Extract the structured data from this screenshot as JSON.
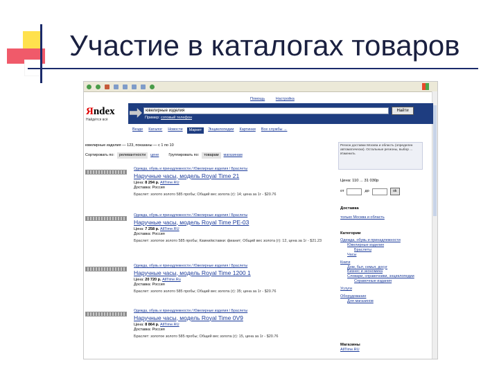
{
  "slide": {
    "title": "Участие в каталогах товаров"
  },
  "toplinks": [
    "Помощь",
    "Настройка"
  ],
  "logo": {
    "y": "Я",
    "rest": "ndex",
    "sub": "Найдётся всё"
  },
  "search": {
    "value": "ювелирные изделия",
    "button": "Найти",
    "example_prefix": "Пример: ",
    "example": "сотовый телефон"
  },
  "tabs": [
    "Везде",
    "Каталог",
    "Новости",
    "Маркет",
    "Энциклопедии",
    "Картинки",
    "Все службы →"
  ],
  "results": {
    "found": "ювелирные изделия — 123, показаны — с 1 по 10",
    "sort_label": "Сортировать по:",
    "sort_relevance": "релевантности",
    "sort_price": "цене",
    "group_label": "Группировать по:",
    "group_goods": "товарам",
    "group_shops": "магазинам"
  },
  "region": "Регион доставки Москва и область (определен автоматически). Остальные регионы, выбор ... Изменить",
  "products": [
    {
      "crumb": "Одежда, обувь и принадлежности / Ювелирные изделия / Браслеты",
      "title": "Наручные часы, модель Royal Time 21",
      "price_label": "Цена: ",
      "price": "8 294 р.",
      "shop": "AllTime.RU",
      "delivery": "Доставка: Россия",
      "desc": "Браслет: золото золото 585 пробы; Общий вес золота (г): 14; цена за 1г - $20.76"
    },
    {
      "crumb": "Одежда, обувь и принадлежности / Ювелирные изделия / Браслеты",
      "title": "Наручные часы, модель Royal Time РЕ-03",
      "price_label": "Цена: ",
      "price": "7 258 р.",
      "shop": "AllTime.RU",
      "delivery": "Доставка: Россия",
      "desc": "Браслет: золотое золото 585 пробы; Камни/вставки: фианит; Общий вес золота (г): 12, цена за 1г - $21.23"
    },
    {
      "crumb": "Одежда, обувь и принадлежности / Ювелирные изделия / Браслеты",
      "title": "Наручные часы, модель Royal Time 1200 1",
      "price_label": "Цена: ",
      "price": "20 720 р.",
      "shop": "AllTime.Ru",
      "delivery": "Доставка: Россия",
      "desc": "Браслет: золото золото 585 пробы; Общий вес золота (г): 35; цена за 1г - $20.76"
    },
    {
      "crumb": "Одежда, обувь и принадлежности / Ювелирные изделия / Браслеты",
      "title": "Наручные часы, модель Royal Time 0V9",
      "price_label": "Цена: ",
      "price": "8 864 р.",
      "shop": "AllTime.RU",
      "delivery": "Доставка: Россия",
      "desc": "Браслет: золотое золото 585 пробы; Общий вес золота (г): 15, цена за 1г - $20.76"
    }
  ],
  "sidebar": {
    "price_title": "Цена: 110 ... 31 030р",
    "from": "от",
    "to": "до",
    "ok": "ok",
    "delivery_title": "Доставка",
    "delivery_link": "только Москва и область",
    "cat_title": "Категории",
    "categories": [
      {
        "label": "Одежда, обувь и принадлежности",
        "level": 0
      },
      {
        "label": "Ювелирные изделия",
        "level": 1
      },
      {
        "label": "Браслеты",
        "level": 2
      },
      {
        "label": "Часы",
        "level": 1
      },
      {
        "label": "Книги",
        "level": 0
      },
      {
        "label": "Дом, быт, семья, досуг",
        "level": 1
      },
      {
        "label": "Бизнес и экономика",
        "level": 1
      },
      {
        "label": "Словари, справочники, энциклопедии",
        "level": 1
      },
      {
        "label": "Справочные издания",
        "level": 2
      },
      {
        "label": "Услуги",
        "level": 0
      },
      {
        "label": "Оборудование",
        "level": 0
      },
      {
        "label": "Для магазинов",
        "level": 1
      }
    ],
    "shops_title": "Магазины",
    "shop": "AllTime.RU"
  }
}
